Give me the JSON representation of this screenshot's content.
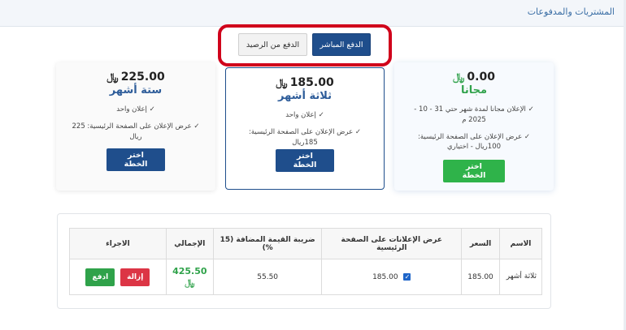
{
  "header": {
    "title": "المشتريات والمدفوعات"
  },
  "payment_toggle": {
    "direct_label": "الدفع المباشر",
    "balance_label": "الدفع من الرصيد"
  },
  "currency_symbol": "﷼",
  "plans": [
    {
      "price": "225.00",
      "name": "ستة أشهر",
      "features": [
        "✓ إعلان واحد",
        "✓ عرض الإعلان على الصفحة الرئيسية: 225 ريال"
      ],
      "button": "اختر الخطة"
    },
    {
      "price": "185.00",
      "name": "ثلاثة أشهر",
      "features": [
        "✓ إعلان واحد",
        "✓ عرض الإعلان على الصفحة الرئيسية: 185ريال"
      ],
      "button": "اختر الخطة"
    },
    {
      "price": "0.00",
      "name": "مجانا",
      "features": [
        "✓ الإعلان مجانا لمدة شهر حتي 31 - 10 - 2025 م",
        "✓ عرض الإعلان على الصفحة الرئيسية: 100ريال - اختياري"
      ],
      "button": "اختر الخطة"
    }
  ],
  "table": {
    "headers": {
      "name": "الاسم",
      "price": "السعر",
      "featured": "عرض الإعلانات على الصفحة الرئيسية",
      "vat": "ضريبة القيمة المضافة (15 %)",
      "total": "الإجمالي",
      "actions": "الاجراء"
    },
    "row": {
      "name": "ثلاثة أشهر",
      "price": "185.00",
      "featured_price": "185.00",
      "vat": "55.50",
      "total": "425.50",
      "remove_label": "إزالة",
      "pay_label": "ادفع"
    }
  }
}
